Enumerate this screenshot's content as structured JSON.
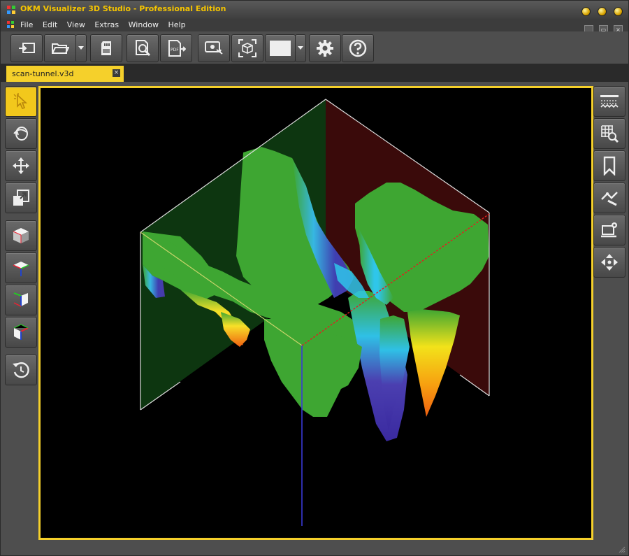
{
  "app": {
    "title": "OKM Visualizer 3D Studio - Professional Edition"
  },
  "menu": {
    "items": [
      "File",
      "Edit",
      "View",
      "Extras",
      "Window",
      "Help"
    ]
  },
  "toolbar": {
    "buttons": [
      {
        "icon": "import-icon"
      },
      {
        "icon": "open-folder-icon"
      },
      {
        "icon": "dropdown-arrow-icon"
      },
      {
        "icon": "sd-card-icon"
      },
      {
        "icon": "print-preview-icon"
      },
      {
        "icon": "export-pdf-icon"
      },
      {
        "icon": "screenshot-icon"
      },
      {
        "icon": "fit-view-icon"
      },
      {
        "icon": "color-swatch-icon"
      },
      {
        "icon": "dropdown-arrow-icon"
      },
      {
        "icon": "settings-icon"
      },
      {
        "icon": "help-icon"
      }
    ]
  },
  "tabs": [
    {
      "label": "scan-tunnel.v3d",
      "active": true
    }
  ],
  "left_tools": [
    {
      "icon": "select-pointer-icon",
      "active": true
    },
    {
      "icon": "rotate-icon"
    },
    {
      "icon": "pan-move-icon"
    },
    {
      "icon": "zoom-box-icon"
    },
    {
      "icon": "view-3d-cube-icon"
    },
    {
      "icon": "view-top-icon"
    },
    {
      "icon": "view-side-icon"
    },
    {
      "icon": "view-front-icon"
    },
    {
      "icon": "reset-view-icon"
    }
  ],
  "right_tools": [
    {
      "icon": "ground-layer-icon"
    },
    {
      "icon": "grid-zoom-icon"
    },
    {
      "icon": "bookmark-icon"
    },
    {
      "icon": "measure-icon"
    },
    {
      "icon": "device-settings-icon"
    },
    {
      "icon": "navigation-icon"
    }
  ],
  "colors": {
    "accent": "#f5d02b",
    "viewport_bg": "#000000",
    "chrome": "#4e4e4e"
  }
}
